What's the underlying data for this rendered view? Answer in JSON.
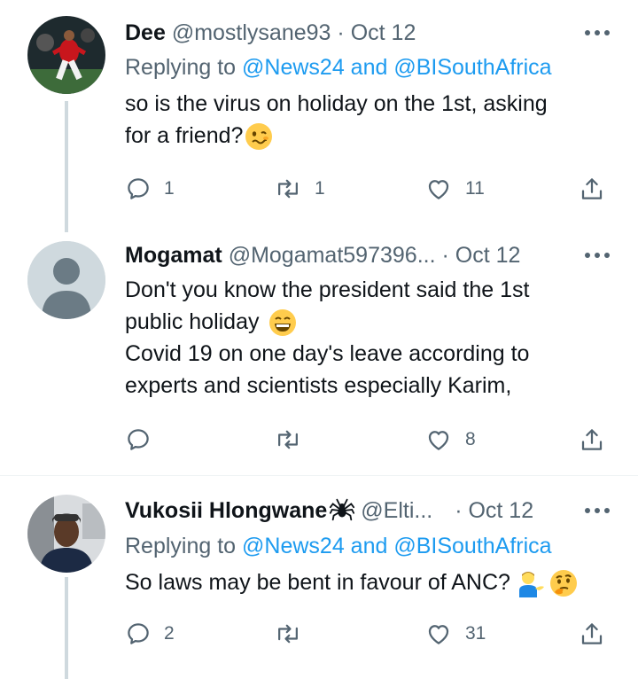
{
  "tweets": [
    {
      "name": "Dee",
      "handle": "@mostlysane93",
      "sep": "·",
      "date": "Oct 12",
      "replying_prefix": "Replying to ",
      "replying_mentions": "@News24 and @BISouthAfrica",
      "text_line1": "so is the virus on holiday on the 1st, asking",
      "text_line2": "for a friend?",
      "emoji": "woozy-face",
      "replies": "1",
      "retweets": "1",
      "likes": "11"
    },
    {
      "name": "Mogamat",
      "handle": "@Mogamat597396...",
      "sep": "·",
      "date": "Oct 12",
      "text_line1": "Don't you know the president said the 1st",
      "text_line2": "public holiday",
      "emoji": "grinning-face",
      "text_line3": "Covid 19 on one day's leave according to",
      "text_line4": "experts and scientists especially Karim,",
      "replies": "",
      "retweets": "",
      "likes": "8"
    },
    {
      "name": "Vukosii Hlongwane",
      "name_emoji": "spider",
      "handle": "@Elti...",
      "sep": "·",
      "date": "Oct 12",
      "replying_prefix": "Replying to ",
      "replying_mentions": "@News24 and @BISouthAfrica",
      "text_line1": "So laws may be bent in favour of ANC?",
      "emojis": [
        "person-tipping-hand",
        "thinking-face"
      ],
      "replies": "2",
      "retweets": "",
      "likes": "31"
    }
  ],
  "colors": {
    "text": "#0f1419",
    "secondary": "#536471",
    "link": "#1d9bf0",
    "thread_line": "#cfd9de",
    "divider": "#eff3f4"
  },
  "icons": [
    "reply-icon",
    "retweet-icon",
    "like-icon",
    "share-icon",
    "more-icon"
  ]
}
